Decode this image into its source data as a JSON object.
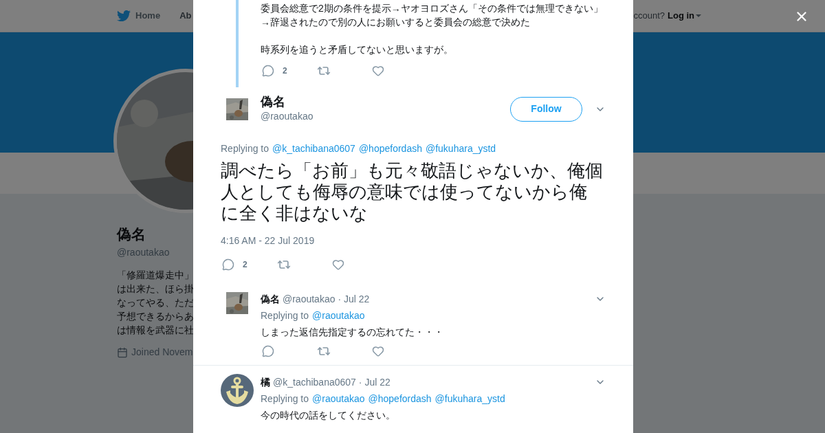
{
  "background_page": {
    "nav": {
      "home": "Home",
      "about": "Ab",
      "account_prompt": "ccount?",
      "login": "Log in"
    },
    "profile": {
      "name": "偽名",
      "handle": "@raoutakao",
      "bio_lines": [
        "「修羅道爆走中」",
        "は出来た、ほら掛",
        "なってやる、ただ",
        "予想できるからあ",
        "は情報を武器に社"
      ],
      "joined": "Joined Novem"
    }
  },
  "modal": {
    "parent_tweet": {
      "paragraphs": [
        "委員会総意で2期の条件を提示→ヤオヨロズさん「その条件では無理できない」\n→辞退されたので別の人にお願いすると委員会の総意で決めた",
        "時系列を追うと矛盾してないと思いますが。"
      ],
      "reply_count": "2"
    },
    "main_tweet": {
      "name": "偽名",
      "handle": "@raoutakao",
      "follow": "Follow",
      "replying_label": "Replying to",
      "replying_to": [
        "@k_tachibana0607",
        "@hopefordash",
        "@fukuhara_ystd"
      ],
      "text": "調べたら「お前」も元々敬語じゃないか、俺個人としても侮辱の意味では使ってないから俺に全く非はないな",
      "timestamp": "4:16 AM - 22 Jul 2019",
      "reply_count": "2"
    },
    "replies": [
      {
        "name": "偽名",
        "handle": "@raoutakao",
        "date": "· Jul 22",
        "replying_label": "Replying to",
        "replying_to": [
          "@raoutakao"
        ],
        "text": "しまった返信先指定するの忘れてた・・・",
        "actions": true
      },
      {
        "kind": "anchor",
        "name": "橘",
        "handle": "@k_tachibana0607",
        "date": "· Jul 22",
        "replying_label": "Replying to",
        "replying_to": [
          "@raoutakao",
          "@hopefordash",
          "@fukuhara_ystd"
        ],
        "text": "今の時代の話をしてください。",
        "actions": false
      }
    ]
  }
}
